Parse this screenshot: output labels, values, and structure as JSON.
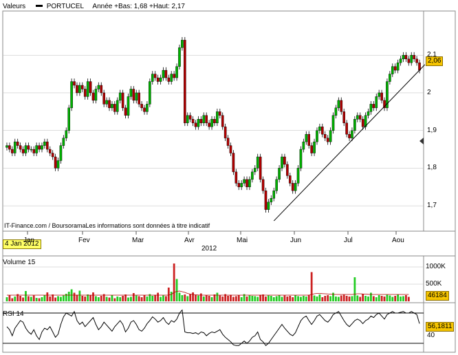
{
  "header": {
    "legend_label": "Valeurs",
    "series_label": "PORTUCEL",
    "year_stats": "Année +Bas: 1,68 +Haut: 2,17"
  },
  "credit": "IT-Finance.com / BoursoramaLes informations sont données à titre indicatif",
  "date_tag": "4 Jan 2012",
  "year_label": "2012",
  "months": [
    "Jan",
    "Fev",
    "Mar",
    "Avr",
    "Mai",
    "Jun",
    "Jul",
    "Aou"
  ],
  "price_axis": {
    "ticks": [
      "2,1",
      "2",
      "1,9",
      "1,8",
      "1,7"
    ],
    "tick_values": [
      2.1,
      2.0,
      1.9,
      1.8,
      1.7
    ],
    "ymin": 1.64,
    "ymax": 2.21
  },
  "last_price_label": "2,06",
  "volume": {
    "title": "Volume 15",
    "ticks": [
      "1000K",
      "500K"
    ],
    "tick_values": [
      1000000,
      500000
    ],
    "ymax": 1200000,
    "last_label": "46184"
  },
  "rsi": {
    "title": "RSI 14",
    "ticks": [
      "40"
    ],
    "tick_values": [
      40
    ],
    "levels": [
      30,
      70
    ],
    "ymin": 20,
    "ymax": 80,
    "last_label": "56,1811"
  },
  "colors": {
    "up": "#00b000",
    "down": "#b00000",
    "volume_up": "#22cc22",
    "volume_down": "#cc2222",
    "ma": "#b00000",
    "trend": "#000000",
    "grid": "#bbbbbb",
    "tag": "#f5c400"
  },
  "chart_data": {
    "type": "candlestick",
    "title": "PORTUCEL",
    "period": "2012",
    "x_labels": [
      "Jan",
      "Fev",
      "Mar",
      "Avr",
      "Mai",
      "Jun",
      "Jul",
      "Aou"
    ],
    "close": [
      1.86,
      1.85,
      1.84,
      1.87,
      1.86,
      1.85,
      1.84,
      1.86,
      1.85,
      1.85,
      1.84,
      1.86,
      1.85,
      1.86,
      1.87,
      1.85,
      1.84,
      1.83,
      1.8,
      1.82,
      1.86,
      1.88,
      1.9,
      1.96,
      2.03,
      2.02,
      2.0,
      2.02,
      2.01,
      1.99,
      2.03,
      2.0,
      1.98,
      2.01,
      2.02,
      2.0,
      1.97,
      1.98,
      1.96,
      1.97,
      1.95,
      1.98,
      2.0,
      1.96,
      1.94,
      1.99,
      2.01,
      1.98,
      2.0,
      1.97,
      1.96,
      1.95,
      1.97,
      2.03,
      2.05,
      2.04,
      2.03,
      2.04,
      2.06,
      2.04,
      2.03,
      2.05,
      2.04,
      2.07,
      2.12,
      2.14,
      1.92,
      1.94,
      1.93,
      1.92,
      1.91,
      1.93,
      1.92,
      1.94,
      1.92,
      1.91,
      1.93,
      1.92,
      1.95,
      1.94,
      1.91,
      1.88,
      1.86,
      1.84,
      1.79,
      1.76,
      1.75,
      1.76,
      1.77,
      1.75,
      1.77,
      1.79,
      1.8,
      1.83,
      1.77,
      1.74,
      1.69,
      1.71,
      1.72,
      1.74,
      1.77,
      1.8,
      1.83,
      1.81,
      1.78,
      1.76,
      1.74,
      1.76,
      1.8,
      1.85,
      1.87,
      1.89,
      1.86,
      1.84,
      1.87,
      1.9,
      1.91,
      1.89,
      1.88,
      1.87,
      1.9,
      1.94,
      1.96,
      1.98,
      1.95,
      1.92,
      1.89,
      1.88,
      1.9,
      1.93,
      1.94,
      1.93,
      1.91,
      1.94,
      1.95,
      1.97,
      1.96,
      1.99,
      2.0,
      1.98,
      1.96,
      2.03,
      2.05,
      2.07,
      2.06,
      2.08,
      2.09,
      2.1,
      2.09,
      2.08,
      2.1,
      2.09,
      2.08,
      2.06
    ],
    "volume": [
      120000,
      180000,
      90000,
      140000,
      210000,
      160000,
      110000,
      300000,
      150000,
      130000,
      170000,
      100000,
      90000,
      120000,
      180000,
      260000,
      140000,
      200000,
      110000,
      150000,
      130000,
      170000,
      220000,
      280000,
      350000,
      250000,
      190000,
      310000,
      160000,
      140000,
      200000,
      180000,
      260000,
      150000,
      120000,
      160000,
      210000,
      130000,
      110000,
      180000,
      90000,
      140000,
      120000,
      160000,
      200000,
      110000,
      130000,
      240000,
      170000,
      150000,
      120000,
      180000,
      140000,
      210000,
      160000,
      190000,
      250000,
      130000,
      170000,
      150000,
      400000,
      280000,
      1100000,
      650000,
      250000,
      180000,
      200000,
      150000,
      210000,
      260000,
      190000,
      170000,
      230000,
      140000,
      180000,
      160000,
      120000,
      200000,
      250000,
      170000,
      140000,
      210000,
      160000,
      190000,
      130000,
      150000,
      180000,
      120000,
      210000,
      140000,
      170000,
      160000,
      150000,
      130000,
      190000,
      200000,
      140000,
      170000,
      160000,
      120000,
      150000,
      180000,
      130000,
      170000,
      140000,
      160000,
      120000,
      180000,
      150000,
      130000,
      160000,
      140000,
      190000,
      850000,
      170000,
      140000,
      200000,
      120000,
      160000,
      180000,
      150000,
      250000,
      140000,
      130000,
      170000,
      190000,
      160000,
      140000,
      150000,
      700000,
      170000,
      130000,
      210000,
      160000,
      140000,
      250000,
      150000,
      120000,
      180000,
      160000,
      140000,
      190000,
      170000,
      130000,
      160000,
      200000,
      140000,
      150000,
      180000,
      130000
    ],
    "volume_ma": [
      180000,
      180000,
      180000,
      180000,
      180000,
      180000,
      180000,
      180000,
      180000,
      180000,
      180000,
      180000,
      180000,
      180000,
      180000,
      180000,
      180000,
      180000,
      180000,
      180000,
      180000,
      180000,
      180000,
      180000,
      180000,
      180000,
      180000,
      180000,
      180000,
      180000,
      180000,
      180000,
      180000,
      180000,
      180000,
      180000,
      180000,
      180000,
      180000,
      180000,
      180000,
      180000,
      180000,
      180000,
      180000,
      180000,
      180000,
      180000,
      180000,
      180000,
      180000,
      180000,
      180000,
      180000,
      180000,
      180000,
      180000,
      180000,
      180000,
      180000,
      180000,
      200000,
      260000,
      290000,
      300000,
      280000,
      260000,
      230000,
      210000,
      200000,
      190000,
      185000,
      180000,
      180000,
      180000,
      180000,
      180000,
      180000,
      180000,
      180000,
      180000,
      180000,
      180000,
      180000,
      180000,
      180000,
      180000,
      180000,
      180000,
      180000,
      180000,
      180000,
      180000,
      180000,
      180000,
      180000,
      180000,
      180000,
      180000,
      180000,
      180000,
      180000,
      180000,
      180000,
      180000,
      180000,
      180000,
      180000,
      180000,
      180000,
      180000,
      180000,
      180000,
      200000,
      220000,
      230000,
      230000,
      225000,
      220000,
      215000,
      210000,
      205000,
      200000,
      200000,
      200000,
      200000,
      200000,
      200000,
      200000,
      210000,
      220000,
      220000,
      215000,
      210000,
      205000,
      200000,
      200000,
      200000,
      200000,
      200000,
      200000,
      200000,
      200000,
      200000,
      200000,
      200000,
      200000,
      200000,
      200000,
      200000
    ],
    "rsi": [
      52,
      48,
      40,
      50,
      55,
      60,
      58,
      50,
      45,
      42,
      48,
      40,
      35,
      45,
      50,
      48,
      52,
      45,
      38,
      42,
      55,
      65,
      70,
      68,
      66,
      72,
      60,
      55,
      58,
      52,
      56,
      60,
      64,
      55,
      48,
      52,
      58,
      54,
      50,
      46,
      52,
      56,
      60,
      55,
      45,
      50,
      58,
      60,
      55,
      48,
      46,
      50,
      56,
      60,
      65,
      62,
      58,
      60,
      64,
      58,
      55,
      60,
      58,
      62,
      70,
      74,
      45,
      44,
      44,
      43,
      44,
      42,
      45,
      44,
      40,
      43,
      45,
      44,
      46,
      48,
      42,
      38,
      35,
      32,
      28,
      27,
      27,
      30,
      33,
      30,
      33,
      38,
      40,
      45,
      35,
      32,
      27,
      30,
      35,
      40,
      45,
      50,
      55,
      50,
      46,
      42,
      40,
      44,
      52,
      60,
      64,
      66,
      60,
      55,
      60,
      66,
      68,
      64,
      60,
      58,
      62,
      68,
      70,
      72,
      66,
      60,
      55,
      52,
      56,
      60,
      62,
      60,
      56,
      60,
      62,
      66,
      64,
      68,
      70,
      66,
      62,
      68,
      70,
      72,
      70,
      70,
      71,
      72,
      70,
      70,
      72,
      70,
      68,
      56
    ],
    "trendline": {
      "from": {
        "x_index": 99,
        "price": 1.66
      },
      "to": {
        "x_index": 155,
        "price": 2.075
      }
    }
  }
}
